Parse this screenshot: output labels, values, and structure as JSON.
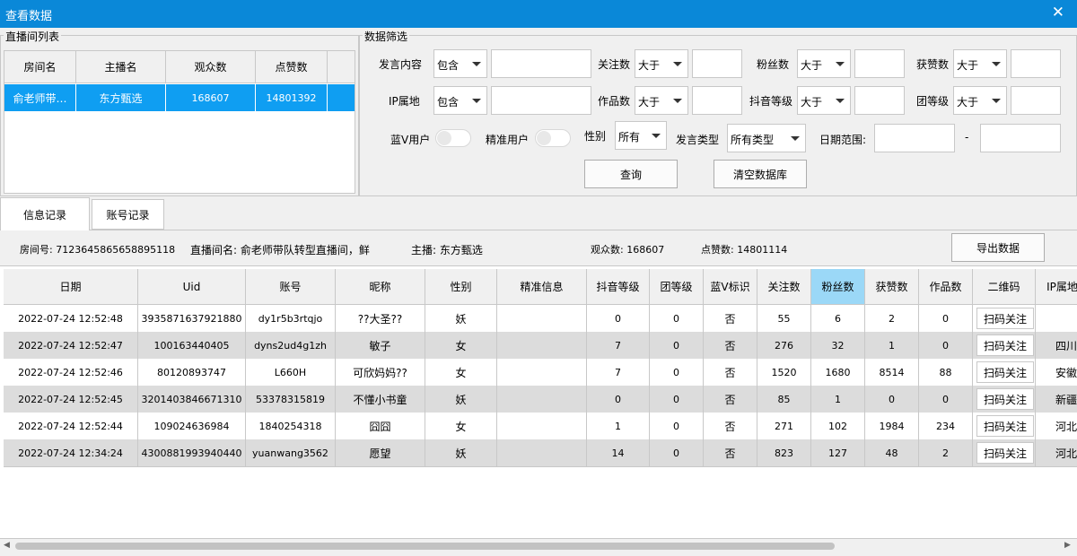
{
  "window": {
    "title": "查看数据",
    "close_glyph": "✕"
  },
  "room_list": {
    "group_title": "直播间列表",
    "columns": [
      "房间名",
      "主播名",
      "观众数",
      "点赞数"
    ],
    "rows": [
      {
        "room": "俞老师带…",
        "anchor": "东方甄选",
        "viewers": "168607",
        "likes": "14801392",
        "selected": true
      }
    ]
  },
  "filter": {
    "group_title": "数据筛选",
    "row1": {
      "content_label": "发言内容",
      "content_op": "包含",
      "follow_label": "关注数",
      "follow_op": "大于",
      "fans_label": "粉丝数",
      "fans_op": "大于",
      "likes_label": "获赞数",
      "likes_op": "大于"
    },
    "row2": {
      "ip_label": "IP属地",
      "ip_op": "包含",
      "works_label": "作品数",
      "works_op": "大于",
      "douyin_label": "抖音等级",
      "douyin_op": "大于",
      "group_label": "团等级",
      "group_op": "大于"
    },
    "row3": {
      "bluev_label": "蓝V用户",
      "precise_label": "精准用户",
      "gender_label": "性别",
      "gender_value": "所有",
      "msgtype_label": "发言类型",
      "msgtype_value": "所有类型",
      "date_label": "日期范围:",
      "date_sep": "-"
    },
    "query_button": "查询",
    "clear_button": "清空数据库"
  },
  "tabs": {
    "info": "信息记录",
    "account": "账号记录"
  },
  "info_bar": {
    "room_no": "房间号: 7123645865658895118",
    "room_name": "直播间名: 俞老师带队转型直播间，鲜",
    "anchor": "主播: 东方甄选",
    "viewers": "观众数: 168607",
    "likes": "点赞数: 14801114",
    "export_button": "导出数据"
  },
  "records": {
    "columns": [
      "日期",
      "Uid",
      "账号",
      "昵称",
      "性别",
      "精准信息",
      "抖音等级",
      "团等级",
      "蓝V标识",
      "关注数",
      "粉丝数",
      "获赞数",
      "作品数",
      "二维码",
      "IP属地"
    ],
    "sorted_column": "粉丝数",
    "qr_label": "扫码关注",
    "rows": [
      {
        "date": "2022-07-24 12:52:48",
        "uid": "3935871637921880",
        "account": "dy1r5b3rtqjo",
        "nick": "??大圣??",
        "gender": "妖",
        "precise": "",
        "douyin": "0",
        "group": "0",
        "bluev": "否",
        "follow": "55",
        "fans": "6",
        "likes": "2",
        "works": "0",
        "ip": ""
      },
      {
        "date": "2022-07-24 12:52:47",
        "uid": "100163440405",
        "account": "dyns2ud4g1zh",
        "nick": "敏子",
        "gender": "女",
        "precise": "",
        "douyin": "7",
        "group": "0",
        "bluev": "否",
        "follow": "276",
        "fans": "32",
        "likes": "1",
        "works": "0",
        "ip": "四川"
      },
      {
        "date": "2022-07-24 12:52:46",
        "uid": "80120893747",
        "account": "L660H",
        "nick": "可欣妈妈??",
        "gender": "女",
        "precise": "",
        "douyin": "7",
        "group": "0",
        "bluev": "否",
        "follow": "1520",
        "fans": "1680",
        "likes": "8514",
        "works": "88",
        "ip": "安徽"
      },
      {
        "date": "2022-07-24 12:52:45",
        "uid": "3201403846671310",
        "account": "53378315819",
        "nick": "不懂小书童",
        "gender": "妖",
        "precise": "",
        "douyin": "0",
        "group": "0",
        "bluev": "否",
        "follow": "85",
        "fans": "1",
        "likes": "0",
        "works": "0",
        "ip": "新疆"
      },
      {
        "date": "2022-07-24 12:52:44",
        "uid": "109024636984",
        "account": "1840254318",
        "nick": "囧囧",
        "gender": "女",
        "precise": "",
        "douyin": "1",
        "group": "0",
        "bluev": "否",
        "follow": "271",
        "fans": "102",
        "likes": "1984",
        "works": "234",
        "ip": "河北"
      },
      {
        "date": "2022-07-24 12:34:24",
        "uid": "4300881993940440",
        "account": "yuanwang3562",
        "nick": "愿望",
        "gender": "妖",
        "precise": "",
        "douyin": "14",
        "group": "0",
        "bluev": "否",
        "follow": "823",
        "fans": "127",
        "likes": "48",
        "works": "2",
        "ip": "河北"
      }
    ]
  },
  "scrollbar": {
    "left_glyph": "◀",
    "right_glyph": "▶"
  },
  "colors": {
    "titlebar": "#0a88d8",
    "selection": "#0f9ef2",
    "sorted_header": "#9bd8f7",
    "alt_row": "#dcdcdc"
  }
}
